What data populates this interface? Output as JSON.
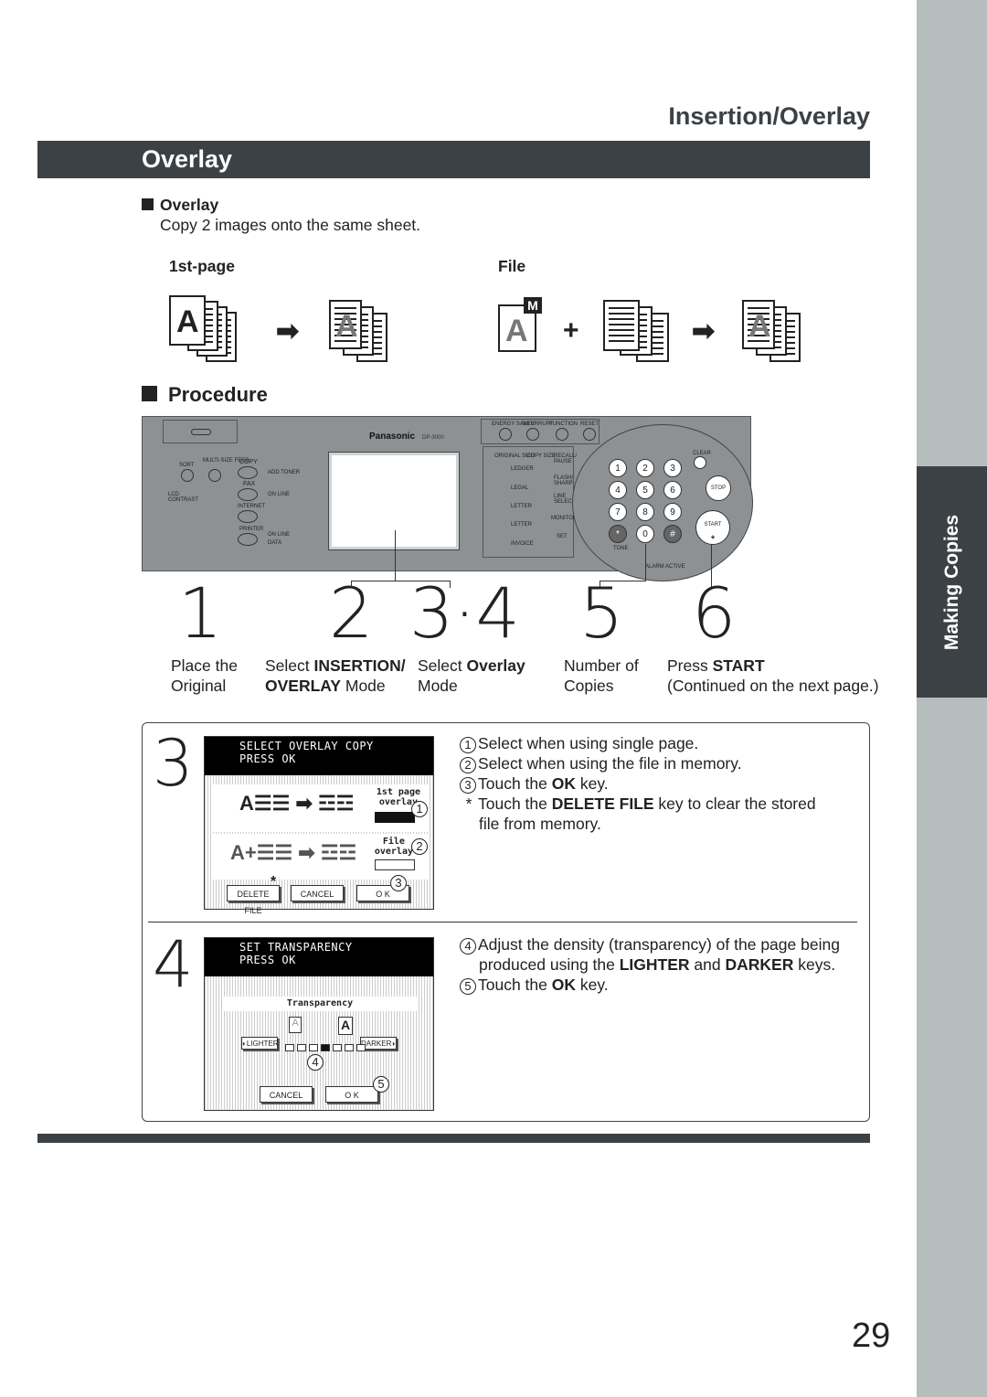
{
  "header": {
    "section": "Insertion/Overlay",
    "bar_title": "Overlay"
  },
  "sidebar": {
    "tab": "Making Copies"
  },
  "overlay": {
    "heading": "Overlay",
    "description": "Copy 2 images onto the same sheet.",
    "col1": "1st-page",
    "col2": "File"
  },
  "procedure": {
    "heading": "Procedure"
  },
  "panel": {
    "brand": "Panasonic",
    "model": "DP-3000",
    "labels": [
      "ENERGY SAVER",
      "INTERRUPT",
      "FUNCTION",
      "RESET",
      "SORT",
      "MULTI-SIZE FEED",
      "COPY",
      "FAX",
      "INTERNET",
      "PRINTER",
      "ADD TONER",
      "ON LINE",
      "ON LINE",
      "DATA",
      "LCD CONTRAST",
      "ORIGINAL SIZE",
      "COPY SIZE",
      "LEDGER",
      "LEGAL",
      "LETTER",
      "LETTER",
      "INVOICE",
      "RECALL/ PAUSE",
      "FLASH/ SHARP",
      "LINE SELECT",
      "MONITOR",
      "SET",
      "CLEAR",
      "STOP",
      "START",
      "TONE",
      "ALARM",
      "ACTIVE"
    ],
    "keys": [
      "1",
      "2",
      "3",
      "4",
      "5",
      "6",
      "7",
      "8",
      "9",
      "*",
      "0",
      "#"
    ]
  },
  "steps": [
    {
      "num": "1",
      "line1": "Place the",
      "line2": "Original"
    },
    {
      "num": "2",
      "line1_pre": "Select ",
      "line1_b": "INSERTION/",
      "line2_b": "OVERLAY",
      "line2_post": " Mode"
    },
    {
      "num": "3·4",
      "line1_pre": "Select ",
      "line1_b": "Overlay",
      "line2": "Mode"
    },
    {
      "num": "5",
      "line1": "Number of",
      "line2": "Copies"
    },
    {
      "num": "6",
      "line1_pre": "Press ",
      "line1_b": "START",
      "line2": "(Continued on the next page.)"
    }
  ],
  "step3": {
    "num": "3",
    "screen_line1": "SELECT OVERLAY COPY",
    "screen_line2": "PRESS OK",
    "opt1_l1": "1st page",
    "opt1_l2": "overlay",
    "opt2_l1": "File",
    "opt2_l2": "overlay",
    "btn_delete": "DELETE FILE",
    "btn_cancel": "CANCEL",
    "btn_ok": "O K",
    "notes": [
      {
        "mark": "1",
        "text": "Select when using single page."
      },
      {
        "mark": "2",
        "text": "Select when using the file in memory."
      },
      {
        "mark": "3",
        "pre": "Touch the ",
        "b": "OK",
        "post": " key."
      },
      {
        "mark": "*",
        "pre": "Touch the ",
        "b": "DELETE FILE",
        "post": " key to clear the stored",
        "line2": "file from memory."
      }
    ]
  },
  "step4": {
    "num": "4",
    "screen_line1": "SET TRANSPARENCY",
    "screen_line2": "PRESS OK",
    "title": "Transparency",
    "btn_lighter": "LIGHTER",
    "btn_darker": "DARKER",
    "level": 4,
    "levels": 7,
    "btn_cancel": "CANCEL",
    "btn_ok": "O K",
    "notes": [
      {
        "mark": "4",
        "text": "Adjust the density (transparency) of the page being",
        "l2_pre": "produced using the ",
        "l2_b1": "LIGHTER",
        "l2_mid": " and ",
        "l2_b2": "DARKER",
        "l2_post": " keys."
      },
      {
        "mark": "5",
        "pre": "Touch the ",
        "b": "OK",
        "post": " key."
      }
    ]
  },
  "page_number": "29",
  "colors": {
    "dark_bar": "#3b4145",
    "sidebar": "#b6bdbd",
    "panel": "#8d9193"
  }
}
